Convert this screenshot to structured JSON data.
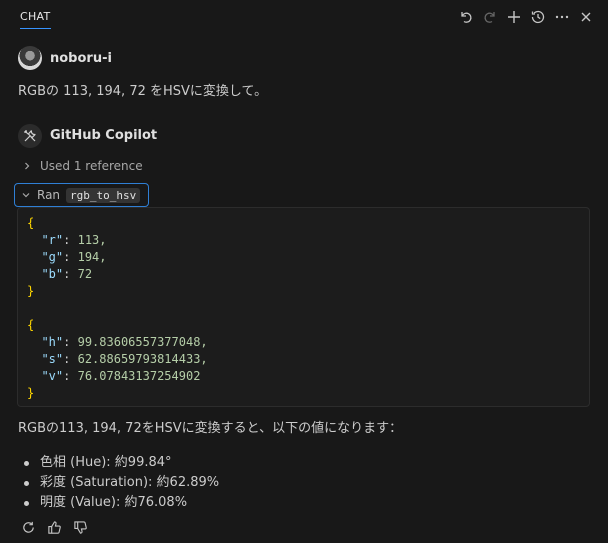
{
  "header": {
    "tab_label": "CHAT",
    "actions": [
      {
        "name": "undo-icon",
        "disabled": false
      },
      {
        "name": "redo-icon",
        "disabled": true
      },
      {
        "name": "add-icon",
        "disabled": false
      },
      {
        "name": "history-icon",
        "disabled": false
      },
      {
        "name": "more-icon",
        "disabled": false
      },
      {
        "name": "close-icon",
        "disabled": false
      }
    ]
  },
  "user": {
    "name": "noboru-i",
    "message": "RGBの 113, 194, 72 をHSVに変換して。"
  },
  "assistant": {
    "name": "GitHub Copilot",
    "references_label": "Used 1 reference",
    "tool_prefix": "Ran",
    "tool_name": "rgb_to_hsv",
    "input": {
      "keys": [
        "\"r\"",
        "\"g\"",
        "\"b\""
      ],
      "values": [
        "113,",
        "194,",
        "72"
      ]
    },
    "output": {
      "keys": [
        "\"h\"",
        "\"s\"",
        "\"v\""
      ],
      "values": [
        "99.83606557377048,",
        "62.88659793814433,",
        "76.07843137254902"
      ]
    },
    "open_brace": "{",
    "close_brace": "}",
    "colon": ": ",
    "answer_text": "RGBの113, 194, 72をHSVに変換すると、以下の値になります：",
    "bullets": [
      "色相 (Hue): 約99.84°",
      "彩度 (Saturation): 約62.89%",
      "明度 (Value): 約76.08%"
    ]
  },
  "colors": {
    "accent": "#3794ff",
    "background": "#181818",
    "json_key": "#9cdcfe",
    "json_number": "#b5cea8",
    "json_brace": "#ffd700"
  }
}
